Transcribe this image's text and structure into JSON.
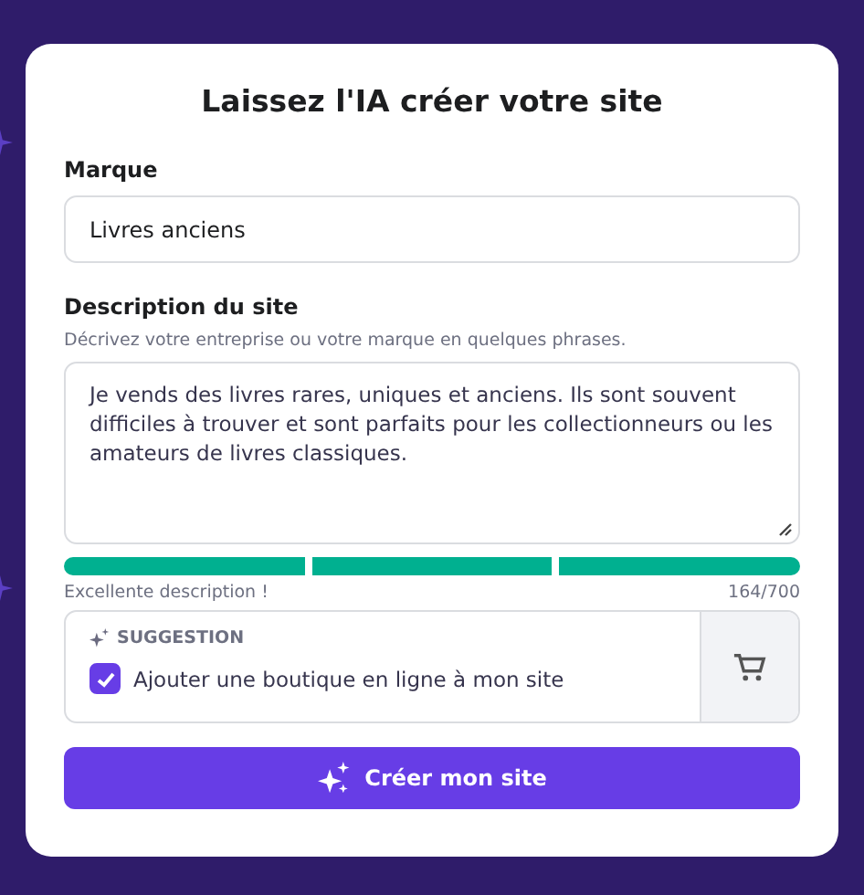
{
  "title": "Laissez l'IA créer votre site",
  "brand": {
    "label": "Marque",
    "value": "Livres anciens"
  },
  "description": {
    "label": "Description du site",
    "hint": "Décrivez votre entreprise ou votre marque en quelques phrases.",
    "value": "Je vends des livres rares, uniques et anciens. Ils sont souvent difficiles à trouver et sont parfaits pour les collectionneurs ou les amateurs de livres classiques.",
    "segments": [
      {
        "filled": true
      },
      {
        "filled": true
      },
      {
        "filled": true
      }
    ],
    "rating": "Excellente description !",
    "count": "164/700"
  },
  "suggestion": {
    "heading": "SUGGESTION",
    "label": "Ajouter une boutique en ligne à mon site",
    "checked": true
  },
  "submit": "Créer mon site"
}
